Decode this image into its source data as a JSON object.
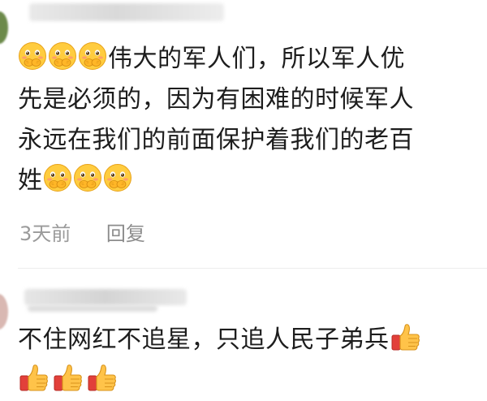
{
  "comments": [
    {
      "emoji_prefix": [
        "shy-hands-over-mouth-emoji",
        "shy-hands-over-mouth-emoji",
        "shy-hands-over-mouth-emoji"
      ],
      "line1": "伟大的军人们，所以军人优",
      "line2": "先是必须的，因为有困难的时候军人",
      "line3": "永远在我们的前面保护着我们的老百",
      "line4": "姓",
      "emoji_suffix": [
        "shy-hands-over-mouth-emoji",
        "shy-hands-over-mouth-emoji",
        "shy-hands-over-mouth-emoji"
      ],
      "time": "3天前",
      "reply_label": "回复"
    },
    {
      "line1": "不住网红不追星，只追人民子弟兵",
      "emoji_inline": [
        "thumbs-up-emoji"
      ],
      "emoji_line2": [
        "thumbs-up-emoji",
        "thumbs-up-emoji",
        "thumbs-up-emoji"
      ]
    }
  ],
  "colors": {
    "text": "#1d1d1d",
    "meta": "#9a9a9a",
    "emoji_face": "#ffc83d",
    "thumb": "#f5a623"
  }
}
